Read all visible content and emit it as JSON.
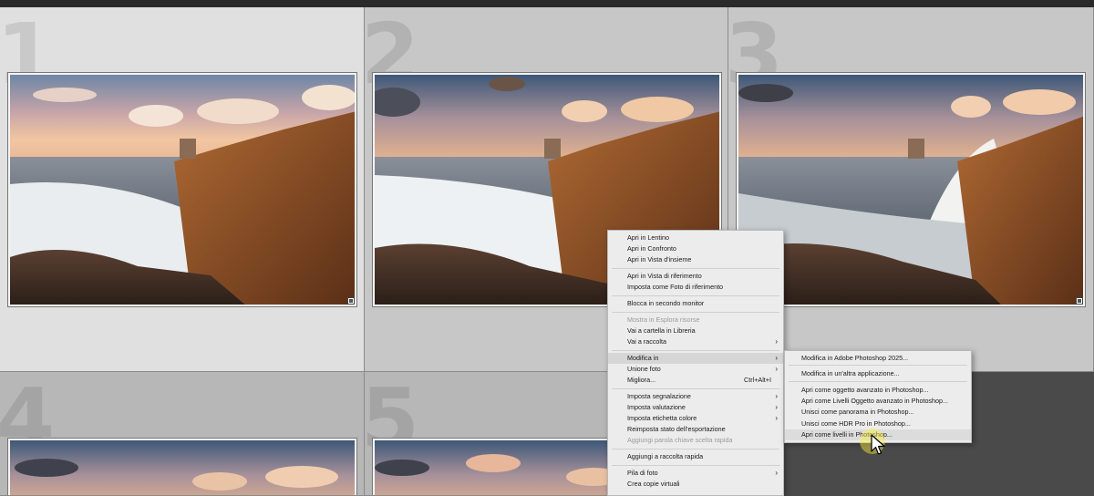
{
  "grid": {
    "cells": [
      {
        "number": "1",
        "state": "light"
      },
      {
        "number": "2",
        "state": "selected"
      },
      {
        "number": "3",
        "state": "selected"
      },
      {
        "number": "4",
        "state": "normal"
      },
      {
        "number": "5",
        "state": "normal"
      }
    ]
  },
  "context_menu": {
    "items": [
      {
        "label": "Apri in Lentino"
      },
      {
        "label": "Apri in Confronto"
      },
      {
        "label": "Apri in Vista d'insieme"
      },
      {
        "label": "Apri in Vista di riferimento"
      },
      {
        "label": "Imposta come Foto di riferimento"
      },
      {
        "label": "Blocca in secondo monitor"
      },
      {
        "label": "Mostra in Esplora risorse",
        "disabled": true
      },
      {
        "label": "Vai a cartella in Libreria"
      },
      {
        "label": "Vai a raccolta",
        "submenu": true
      },
      {
        "label": "Modifica in",
        "submenu": true,
        "active": true
      },
      {
        "label": "Unione foto",
        "submenu": true
      },
      {
        "label": "Migliora...",
        "shortcut": "Ctrl+Alt+I"
      },
      {
        "label": "Imposta segnalazione",
        "submenu": true
      },
      {
        "label": "Imposta valutazione",
        "submenu": true
      },
      {
        "label": "Imposta etichetta colore",
        "submenu": true
      },
      {
        "label": "Reimposta stato dell'esportazione"
      },
      {
        "label": "Aggiungi parola chiave scelta rapida",
        "disabled": true
      },
      {
        "label": "Aggiungi a raccolta rapida"
      },
      {
        "label": "Pila di foto",
        "submenu": true
      },
      {
        "label": "Crea copie virtuali"
      }
    ]
  },
  "submenu": {
    "items": [
      {
        "label": "Modifica in Adobe Photoshop 2025..."
      },
      {
        "label": "Modifica in un'altra applicazione..."
      },
      {
        "label": "Apri come oggetto avanzato in Photoshop..."
      },
      {
        "label": "Apri come Livelli Oggetto avanzato in Photoshop..."
      },
      {
        "label": "Unisci come panorama in Photoshop..."
      },
      {
        "label": "Unisci come HDR Pro in Photoshop..."
      },
      {
        "label": "Apri come livelli in Photoshop...",
        "highlighted": true
      }
    ]
  },
  "icons": {
    "submenu_arrow": "chevron-right-icon",
    "cursor": "mouse-pointer-icon"
  },
  "colors": {
    "menu_bg": "#ececec",
    "highlight": "#f5ec3c",
    "grid_selected": "#c7c7c7",
    "grid_light": "#e0e0e0"
  }
}
